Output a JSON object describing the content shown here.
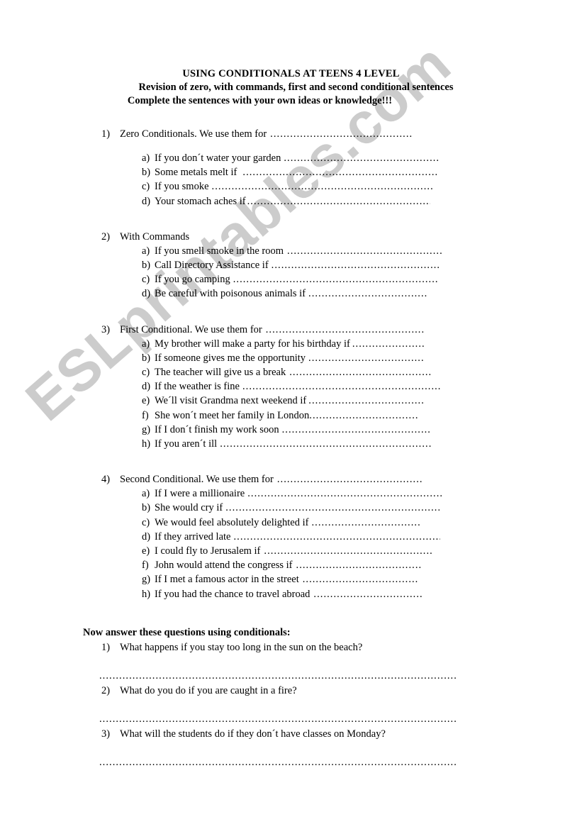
{
  "document": {
    "title_line_1": "USING CONDITIONALS AT TEENS 4 LEVEL",
    "title_line_2": "Revision of zero, with commands, first and second conditional sentences",
    "title_line_3": "Complete the sentences with your own ideas or knowledge!!!"
  },
  "watermark": {
    "text": "ESLprintables.com",
    "color": "#cccccc"
  },
  "sections": [
    {
      "marker": "1)",
      "heading": "Zero Conditionals. We use them for",
      "heading_dots": "...........................................",
      "items": [
        {
          "marker": "a)",
          "text": "If you don´t water your garden",
          "dots": "..............................................."
        },
        {
          "marker": "b)",
          "text": "Some metals melt if",
          "dots": "..................................................................."
        },
        {
          "marker": "c)",
          "text": "If you smoke",
          "dots": "..........................................................................."
        },
        {
          "marker": "d)",
          "text": "Your stomach aches if",
          "dots": "..............................................................."
        }
      ]
    },
    {
      "marker": "2)",
      "heading": "With Commands",
      "heading_dots": "",
      "items": [
        {
          "marker": "a)",
          "text": "If you smell smoke in the room",
          "dots": "..............................................."
        },
        {
          "marker": "b)",
          "text": "Call Directory Assistance if",
          "dots": "..................................................."
        },
        {
          "marker": "c)",
          "text": "If you go camping",
          "dots": "..................................................................."
        },
        {
          "marker": "d)",
          "text": "Be careful with poisonous animals if",
          "dots": "...................................."
        }
      ]
    },
    {
      "marker": "3)",
      "heading": "First Conditional. We use them for",
      "heading_dots": "................................................",
      "items": [
        {
          "marker": "a)",
          "text": "My brother will make a party for his birthday if",
          "dots": "......................"
        },
        {
          "marker": "b)",
          "text": "If someone gives me the opportunity",
          "dots": "..................................."
        },
        {
          "marker": "c)",
          "text": "The teacher will give us a break",
          "dots": "..........................................."
        },
        {
          "marker": "d)",
          "text": "If the weather is fine",
          "dots": "............................................................"
        },
        {
          "marker": "e)",
          "text": "We´ll visit Grandma next weekend if",
          "dots": "..................................."
        },
        {
          "marker": "f)",
          "text": "She won´t  meet her family in London",
          "dots": "................................."
        },
        {
          "marker": "g)",
          "text": "If I don´t finish my work soon",
          "dots": "............................................."
        },
        {
          "marker": "h)",
          "text": "If you aren´t ill",
          "dots": "................................................................."
        }
      ]
    },
    {
      "marker": "4)",
      "heading": "Second Conditional. We use them for",
      "heading_dots": "............................................",
      "items": [
        {
          "marker": "a)",
          "text": "If I were a millionaire",
          "dots": "..........................................................."
        },
        {
          "marker": "b)",
          "text": "She would cry if",
          "dots": "..................................................................."
        },
        {
          "marker": "c)",
          "text": "We would feel absolutely delighted if",
          "dots": "................................."
        },
        {
          "marker": "d)",
          "text": "If they arrived late",
          "dots": "..............................................................."
        },
        {
          "marker": "e)",
          "text": "I could fly to Jerusalem if",
          "dots": "..................................................."
        },
        {
          "marker": "f)",
          "text": "John would attend the congress if",
          "dots": "......................................"
        },
        {
          "marker": "g)",
          "text": "If I met a famous actor in the street",
          "dots": "..................................."
        },
        {
          "marker": "h)",
          "text": "If you had the chance to travel abroad",
          "dots": "................................."
        }
      ]
    }
  ],
  "questions_section": {
    "heading": "Now answer these questions using conditionals:",
    "items": [
      {
        "marker": "1)",
        "text": "What happens if you stay too long in the sun on the beach?"
      },
      {
        "marker": "2)",
        "text": "What do you do if you are caught in a fire?"
      },
      {
        "marker": "3)",
        "text": "What will the students do if they don´t have classes on Monday?"
      }
    ],
    "answer_line_dots": "............................................................................................................................................."
  }
}
